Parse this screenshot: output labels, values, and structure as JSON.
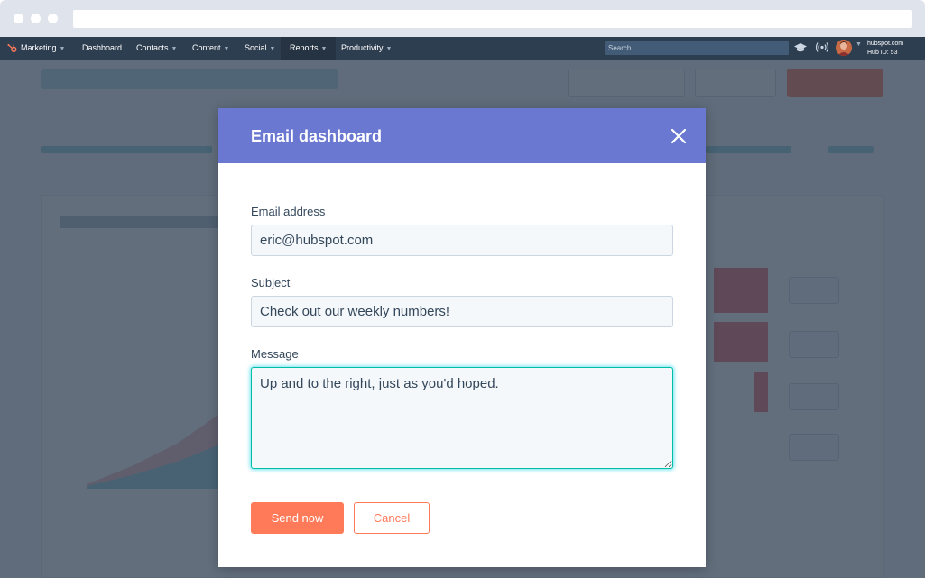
{
  "nav": {
    "app": "Marketing",
    "items": [
      "Dashboard",
      "Contacts",
      "Content",
      "Social",
      "Reports",
      "Productivity"
    ],
    "search_placeholder": "Search",
    "account_domain": "hubspot.com",
    "hub_id": "Hub ID: 53"
  },
  "modal": {
    "title": "Email dashboard",
    "email_label": "Email address",
    "email_value": "eric@hubspot.com",
    "subject_label": "Subject",
    "subject_value": "Check out our weekly numbers!",
    "message_label": "Message",
    "message_value": "Up and to the right, just as you'd hoped.",
    "send_label": "Send now",
    "cancel_label": "Cancel"
  },
  "colors": {
    "header": "#6a78d1",
    "accent": "#ff7a59",
    "focus": "#00bda5",
    "nav": "#2d3e50"
  },
  "icons": [
    "close-icon",
    "hubspot-logo-icon",
    "graduation-cap-icon",
    "broadcast-icon",
    "chevron-down-icon"
  ]
}
